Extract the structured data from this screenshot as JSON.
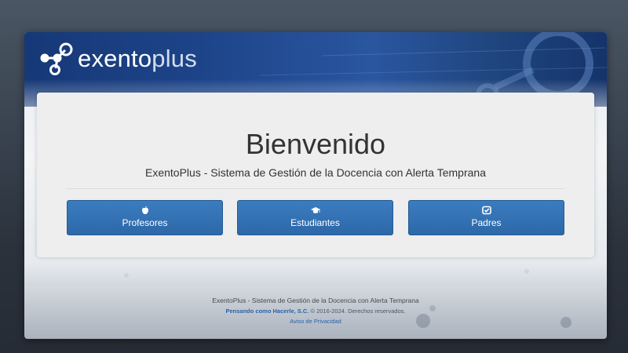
{
  "brand": {
    "name_bold": "exento",
    "name_light": "plus"
  },
  "main": {
    "title": "Bienvenido",
    "subtitle": "ExentoPlus - Sistema de Gestión de la Docencia con Alerta Temprana",
    "buttons": [
      {
        "label": "Profesores",
        "icon": "apple-icon"
      },
      {
        "label": "Estudiantes",
        "icon": "graduation-cap-icon"
      },
      {
        "label": "Padres",
        "icon": "check-square-icon"
      }
    ]
  },
  "footer": {
    "line1": "ExentoPlus - Sistema de Gestión de la Docencia con Alerta Temprana",
    "company_link": "Pensando como Hacerle, S.C.",
    "copyright": "© 2016-2024. Derechos reservados.",
    "privacy_link": "Aviso de Privacidad"
  },
  "colors": {
    "banner": "#1d4489",
    "button": "#2d68a8",
    "link": "#2a62a8"
  }
}
